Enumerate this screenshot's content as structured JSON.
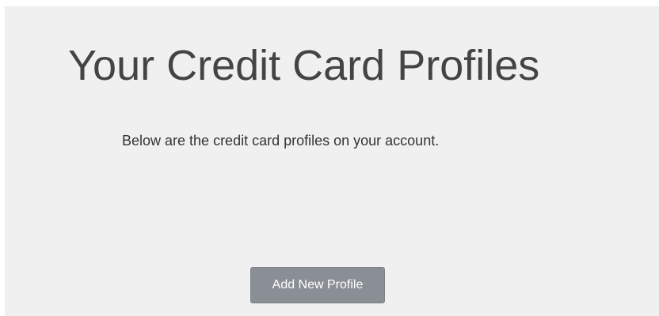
{
  "page": {
    "title": "Your Credit Card Profiles",
    "description": "Below are the credit card profiles on your account."
  },
  "actions": {
    "add_profile_label": "Add New Profile"
  }
}
